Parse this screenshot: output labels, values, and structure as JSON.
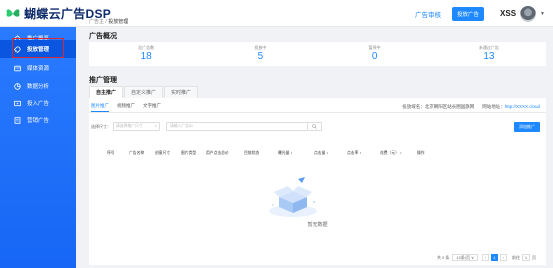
{
  "header": {
    "brand": "蝴蝶云广告DSP",
    "help_link": "广告审核",
    "action_button": "投放广告",
    "user": "XSS"
  },
  "sidebar": {
    "items": [
      {
        "label": "推广概览",
        "icon": "home-icon"
      },
      {
        "label": "投放管理",
        "icon": "rocket-icon",
        "active": true
      },
      {
        "label": "媒体资源",
        "icon": "media-icon"
      },
      {
        "label": "数据分析",
        "icon": "chart-icon"
      },
      {
        "label": "投入广告",
        "icon": "ad-icon"
      },
      {
        "label": "营销广告",
        "icon": "doc-icon"
      }
    ]
  },
  "breadcrumb": {
    "root": "广告主",
    "sep": "/",
    "current": "投放管理"
  },
  "overview": {
    "title": "广告概况",
    "stats": [
      {
        "label": "总广告数",
        "value": "18"
      },
      {
        "label": "投放中",
        "value": "5"
      },
      {
        "label": "暂停中",
        "value": "0"
      },
      {
        "label": "未通过广告",
        "value": "13"
      }
    ]
  },
  "promotion": {
    "title": "推广管理",
    "main_tabs": [
      "自主推广",
      "自定义推广",
      "实时推广"
    ],
    "sub_tabs": [
      "图片推广",
      "视频推广",
      "文字推广"
    ],
    "domain_label": "投放域名：",
    "domain_value": "北京朝阳区站长圈国旗网",
    "domain_link_label": "网站地址：",
    "domain_link": "http://XXXX.cloud",
    "filter": {
      "label": "选择尺寸：",
      "select_placeholder": "请选择推广尺寸",
      "input_placeholder": "请输入广告ID",
      "add_button": "添加推广"
    },
    "columns": [
      "序号",
      "广告名称",
      "创意尺寸",
      "图片类型",
      "用户点击总价",
      "目前状态",
      "曝光量 ↕",
      "点击量 ↕",
      "点击率 ↕",
      "花费（元） ↕",
      "操作"
    ],
    "empty_text": "暂无数据",
    "pagination": {
      "total": "共 0 条",
      "page_size": "10条/页",
      "current_page": "1",
      "goto_prefix": "前往",
      "goto_value": "1",
      "goto_suffix": "页"
    }
  },
  "colors": {
    "primary": "#1e88ff",
    "sidebar": "#1f6fff",
    "highlight_frame": "#e0262d"
  }
}
